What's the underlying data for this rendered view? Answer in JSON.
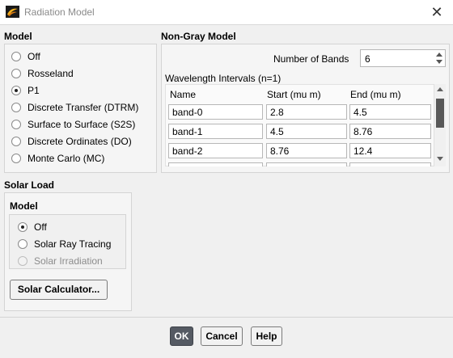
{
  "window": {
    "title": "Radiation Model",
    "close_glyph": "✕"
  },
  "model": {
    "label": "Model",
    "options": [
      {
        "label": "Off",
        "checked": false
      },
      {
        "label": "Rosseland",
        "checked": false
      },
      {
        "label": "P1",
        "checked": true
      },
      {
        "label": "Discrete Transfer (DTRM)",
        "checked": false
      },
      {
        "label": "Surface to Surface (S2S)",
        "checked": false
      },
      {
        "label": "Discrete Ordinates (DO)",
        "checked": false
      },
      {
        "label": "Monte Carlo (MC)",
        "checked": false
      }
    ]
  },
  "non_gray": {
    "label": "Non-Gray Model",
    "bands_label": "Number of Bands",
    "bands_value": "6",
    "intervals_label": "Wavelength Intervals (n=1)",
    "columns": [
      "Name",
      "Start (mu m)",
      "End (mu m)"
    ],
    "rows": [
      [
        "band-0",
        "2.8",
        "4.5"
      ],
      [
        "band-1",
        "4.5",
        "8.76"
      ],
      [
        "band-2",
        "8.76",
        "12.4"
      ]
    ]
  },
  "solar": {
    "label": "Solar Load",
    "model_label": "Model",
    "options": [
      {
        "label": "Off",
        "checked": true,
        "disabled": false
      },
      {
        "label": "Solar Ray Tracing",
        "checked": false,
        "disabled": false
      },
      {
        "label": "Solar Irradiation",
        "checked": false,
        "disabled": true
      }
    ],
    "calculator_label": "Solar Calculator..."
  },
  "buttons": {
    "ok": "OK",
    "cancel": "Cancel",
    "help": "Help"
  },
  "icons": {
    "app": "fluent-logo-icon",
    "close": "close-icon"
  }
}
